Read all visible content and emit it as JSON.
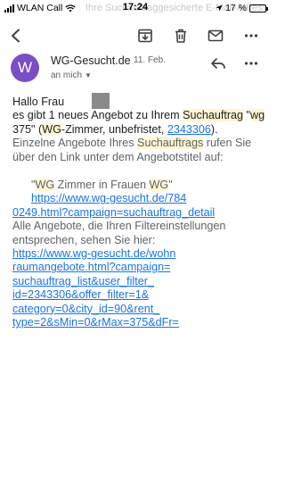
{
  "status": {
    "carrier": "WLAN Call",
    "time": "17:24",
    "battery": "17 %",
    "battery_level": 0.17,
    "ghost_text": "Ihre Suchauftraggesicherte E-Mail-Adresse erhält ihre Angebote hier nicht gerau"
  },
  "toolbar": {
    "back_icon": "back-arrow-icon",
    "archive_icon": "archive-icon",
    "delete_icon": "trash-icon",
    "unread_icon": "mail-icon",
    "more_icon": "more-horizontal-icon"
  },
  "sender": {
    "avatar_letter": "W",
    "avatar_color": "#7b4ec6",
    "name": "WG-Gesucht.de",
    "date": "11. Feb.",
    "recipient": "an mich"
  },
  "body": {
    "greeting": "Hallo Frau",
    "new_offer": {
      "t1": "es gibt 1 neues Angebot zu Ihrem ",
      "hl1": "Suchauftrag",
      "t2": " \"",
      "hl2": "wg",
      "t3": " 375\" (",
      "hl3": "WG",
      "t4": "-Zimmer, unbefristet, ",
      "link": "2343306",
      "t5": ")."
    },
    "info": {
      "t1": "Einzelne Angebote Ihres ",
      "hl1": "Suchauftrags",
      "t2": " rufen Sie über den Link unter dem Angebotstitel auf:"
    },
    "offer": {
      "q1": "\"",
      "hl1": "WG",
      "t1": " Zimmer in Frauen ",
      "hl2": "WG",
      "q2": "\"",
      "link_line1": "https://www.wg-gesucht.de/784",
      "link_line2": "0249.html?campaign=suchauftrag_detail"
    },
    "all": {
      "text": "Alle Angebote, die Ihren Filtereinstellungen entsprechen, sehen Sie hier:",
      "link_lines": [
        "https://www.wg-gesucht.de/wohn",
        "raumangebote.html?campaign=",
        "suchauftrag_list&user_filter_",
        "id=2343306&offer_filter=1&",
        "category=0&city_id=90&rent_",
        "type=2&sMin=0&rMax=375&dFr="
      ]
    }
  }
}
